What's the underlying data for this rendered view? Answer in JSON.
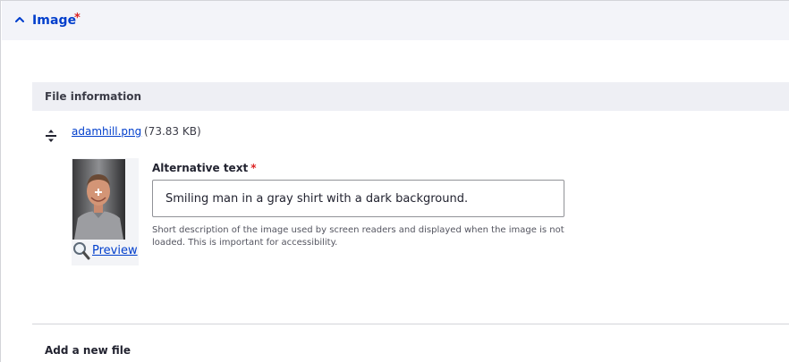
{
  "section": {
    "title": "Image",
    "required_marker": "*",
    "expanded": true,
    "accent_color": "#003ecc",
    "required_color": "#dc2323"
  },
  "file_information": {
    "title": "File information",
    "file_name": "adamhill.png",
    "file_size": "(73.83 KB)",
    "thumbnail_icon": "portrait-photo",
    "preview_label": "Preview"
  },
  "alt_text": {
    "label": "Alternative text",
    "required_marker": "*",
    "value": "Smiling man in a gray shirt with a dark background.",
    "description": "Short description of the image used by screen readers and displayed when the image is not loaded. This is important for accessibility."
  },
  "add_new": {
    "label": "Add a new file"
  }
}
